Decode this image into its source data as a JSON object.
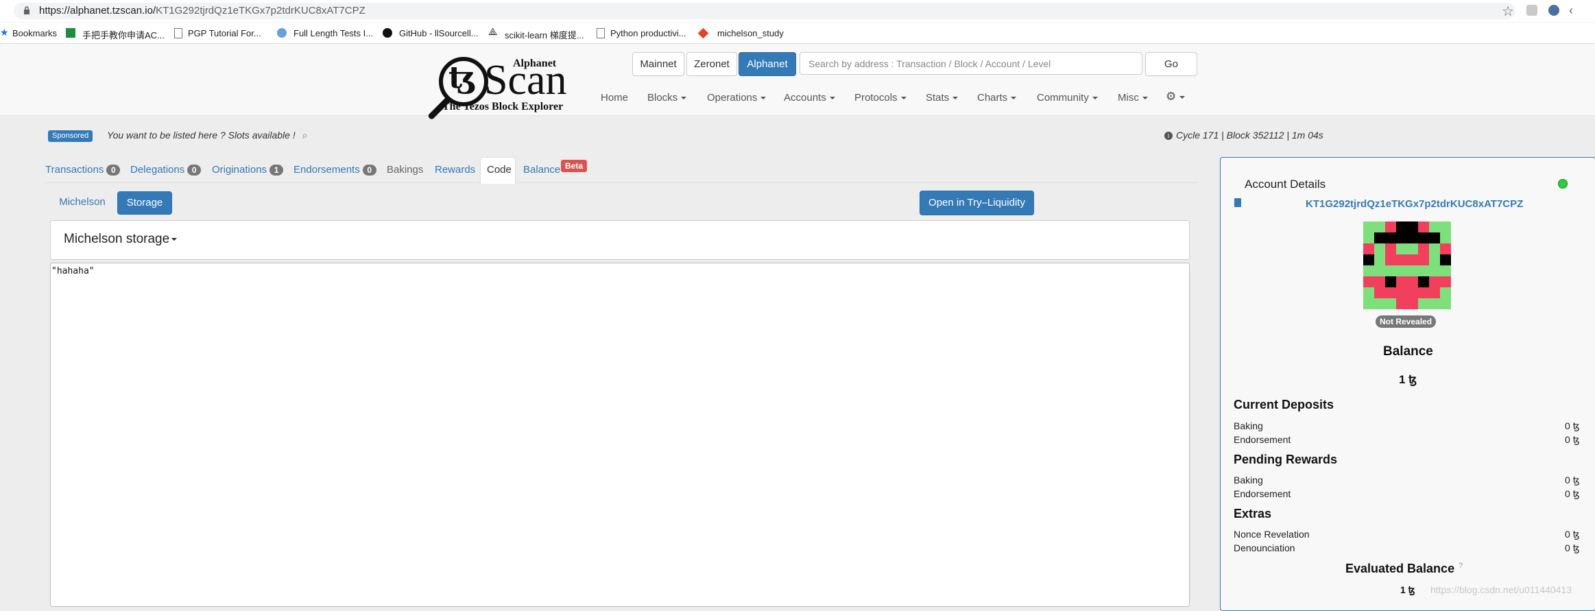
{
  "browser": {
    "url_host": "https://alphanet.tzscan.io/",
    "url_path": "KT1G292tjrdQz1eTKGx7p2tdrKUC8xAT7CPZ",
    "bookmarks": [
      "Bookmarks",
      "手把手教你申请AC...",
      "PGP Tutorial For...",
      "Full Length Tests I...",
      "GitHub - llSourcell...",
      "scikit-learn 梯度提...",
      "Python productivi...",
      "michelson_study"
    ]
  },
  "header": {
    "logo_alphanet": "Alphanet",
    "logo_scan": "Scan",
    "logo_tagline": "The Tezos Block Explorer",
    "networks": [
      "Mainnet",
      "Zeronet",
      "Alphanet"
    ],
    "search_placeholder": "Search by address : Transaction / Block / Account / Level",
    "go_label": "Go",
    "nav": [
      "Home",
      "Blocks",
      "Operations",
      "Accounts",
      "Protocols",
      "Stats",
      "Charts",
      "Community",
      "Misc"
    ]
  },
  "sponsor": {
    "badge": "Sponsored",
    "text": "You want to be listed here ? Slots available !",
    "cycle_info": "Cycle 171 | Block 352112 | 1m 04s"
  },
  "tabs": {
    "transactions": "Transactions",
    "transactions_count": "0",
    "delegations": "Delegations",
    "delegations_count": "0",
    "originations": "Originations",
    "originations_count": "1",
    "endorsements": "Endorsements",
    "endorsements_count": "0",
    "bakings": "Bakings",
    "rewards": "Rewards",
    "code": "Code",
    "balance": "Balance",
    "beta": "Beta"
  },
  "code": {
    "michelson_tab": "Michelson",
    "storage_tab": "Storage",
    "try_button": "Open in Try–Liquidity",
    "storage_title": "Michelson storage",
    "storage_value": "\"hahaha\""
  },
  "account": {
    "title": "Account Details",
    "address": "KT1G292tjrdQz1eTKGx7p2tdrKUC8xAT7CPZ",
    "status": "Not Revealed",
    "balance_title": "Balance",
    "balance_value": "1 ꜩ",
    "current_deposits": "Current Deposits",
    "pending_rewards": "Pending Rewards",
    "extras": "Extras",
    "baking": "Baking",
    "endorsement": "Endorsement",
    "nonce_revelation": "Nonce Revelation",
    "denounciation": "Denounciation",
    "zero": "0 ꜩ",
    "evaluated_title": "Evaluated Balance",
    "evaluated_q": "?",
    "evaluated_value": "1 ꜩ",
    "watermark": "https://blog.csdn.net/u011440413"
  }
}
